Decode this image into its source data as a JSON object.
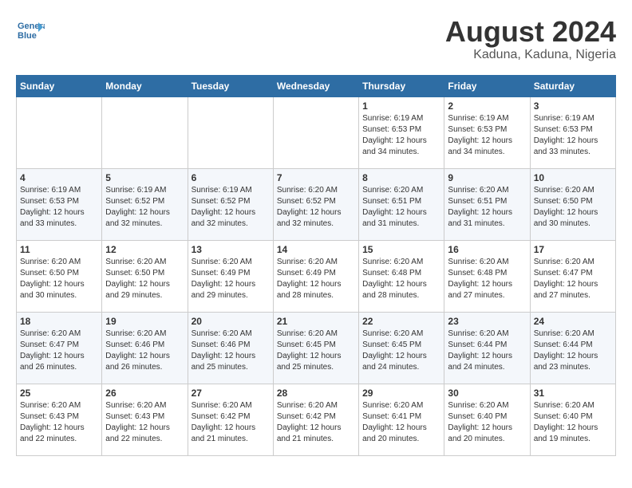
{
  "header": {
    "logo_line1": "General",
    "logo_line2": "Blue",
    "month_year": "August 2024",
    "location": "Kaduna, Kaduna, Nigeria"
  },
  "days_of_week": [
    "Sunday",
    "Monday",
    "Tuesday",
    "Wednesday",
    "Thursday",
    "Friday",
    "Saturday"
  ],
  "weeks": [
    [
      {
        "day": "",
        "info": ""
      },
      {
        "day": "",
        "info": ""
      },
      {
        "day": "",
        "info": ""
      },
      {
        "day": "",
        "info": ""
      },
      {
        "day": "1",
        "info": "Sunrise: 6:19 AM\nSunset: 6:53 PM\nDaylight: 12 hours\nand 34 minutes."
      },
      {
        "day": "2",
        "info": "Sunrise: 6:19 AM\nSunset: 6:53 PM\nDaylight: 12 hours\nand 34 minutes."
      },
      {
        "day": "3",
        "info": "Sunrise: 6:19 AM\nSunset: 6:53 PM\nDaylight: 12 hours\nand 33 minutes."
      }
    ],
    [
      {
        "day": "4",
        "info": "Sunrise: 6:19 AM\nSunset: 6:53 PM\nDaylight: 12 hours\nand 33 minutes."
      },
      {
        "day": "5",
        "info": "Sunrise: 6:19 AM\nSunset: 6:52 PM\nDaylight: 12 hours\nand 32 minutes."
      },
      {
        "day": "6",
        "info": "Sunrise: 6:19 AM\nSunset: 6:52 PM\nDaylight: 12 hours\nand 32 minutes."
      },
      {
        "day": "7",
        "info": "Sunrise: 6:20 AM\nSunset: 6:52 PM\nDaylight: 12 hours\nand 32 minutes."
      },
      {
        "day": "8",
        "info": "Sunrise: 6:20 AM\nSunset: 6:51 PM\nDaylight: 12 hours\nand 31 minutes."
      },
      {
        "day": "9",
        "info": "Sunrise: 6:20 AM\nSunset: 6:51 PM\nDaylight: 12 hours\nand 31 minutes."
      },
      {
        "day": "10",
        "info": "Sunrise: 6:20 AM\nSunset: 6:50 PM\nDaylight: 12 hours\nand 30 minutes."
      }
    ],
    [
      {
        "day": "11",
        "info": "Sunrise: 6:20 AM\nSunset: 6:50 PM\nDaylight: 12 hours\nand 30 minutes."
      },
      {
        "day": "12",
        "info": "Sunrise: 6:20 AM\nSunset: 6:50 PM\nDaylight: 12 hours\nand 29 minutes."
      },
      {
        "day": "13",
        "info": "Sunrise: 6:20 AM\nSunset: 6:49 PM\nDaylight: 12 hours\nand 29 minutes."
      },
      {
        "day": "14",
        "info": "Sunrise: 6:20 AM\nSunset: 6:49 PM\nDaylight: 12 hours\nand 28 minutes."
      },
      {
        "day": "15",
        "info": "Sunrise: 6:20 AM\nSunset: 6:48 PM\nDaylight: 12 hours\nand 28 minutes."
      },
      {
        "day": "16",
        "info": "Sunrise: 6:20 AM\nSunset: 6:48 PM\nDaylight: 12 hours\nand 27 minutes."
      },
      {
        "day": "17",
        "info": "Sunrise: 6:20 AM\nSunset: 6:47 PM\nDaylight: 12 hours\nand 27 minutes."
      }
    ],
    [
      {
        "day": "18",
        "info": "Sunrise: 6:20 AM\nSunset: 6:47 PM\nDaylight: 12 hours\nand 26 minutes."
      },
      {
        "day": "19",
        "info": "Sunrise: 6:20 AM\nSunset: 6:46 PM\nDaylight: 12 hours\nand 26 minutes."
      },
      {
        "day": "20",
        "info": "Sunrise: 6:20 AM\nSunset: 6:46 PM\nDaylight: 12 hours\nand 25 minutes."
      },
      {
        "day": "21",
        "info": "Sunrise: 6:20 AM\nSunset: 6:45 PM\nDaylight: 12 hours\nand 25 minutes."
      },
      {
        "day": "22",
        "info": "Sunrise: 6:20 AM\nSunset: 6:45 PM\nDaylight: 12 hours\nand 24 minutes."
      },
      {
        "day": "23",
        "info": "Sunrise: 6:20 AM\nSunset: 6:44 PM\nDaylight: 12 hours\nand 24 minutes."
      },
      {
        "day": "24",
        "info": "Sunrise: 6:20 AM\nSunset: 6:44 PM\nDaylight: 12 hours\nand 23 minutes."
      }
    ],
    [
      {
        "day": "25",
        "info": "Sunrise: 6:20 AM\nSunset: 6:43 PM\nDaylight: 12 hours\nand 22 minutes."
      },
      {
        "day": "26",
        "info": "Sunrise: 6:20 AM\nSunset: 6:43 PM\nDaylight: 12 hours\nand 22 minutes."
      },
      {
        "day": "27",
        "info": "Sunrise: 6:20 AM\nSunset: 6:42 PM\nDaylight: 12 hours\nand 21 minutes."
      },
      {
        "day": "28",
        "info": "Sunrise: 6:20 AM\nSunset: 6:42 PM\nDaylight: 12 hours\nand 21 minutes."
      },
      {
        "day": "29",
        "info": "Sunrise: 6:20 AM\nSunset: 6:41 PM\nDaylight: 12 hours\nand 20 minutes."
      },
      {
        "day": "30",
        "info": "Sunrise: 6:20 AM\nSunset: 6:40 PM\nDaylight: 12 hours\nand 20 minutes."
      },
      {
        "day": "31",
        "info": "Sunrise: 6:20 AM\nSunset: 6:40 PM\nDaylight: 12 hours\nand 19 minutes."
      }
    ]
  ]
}
